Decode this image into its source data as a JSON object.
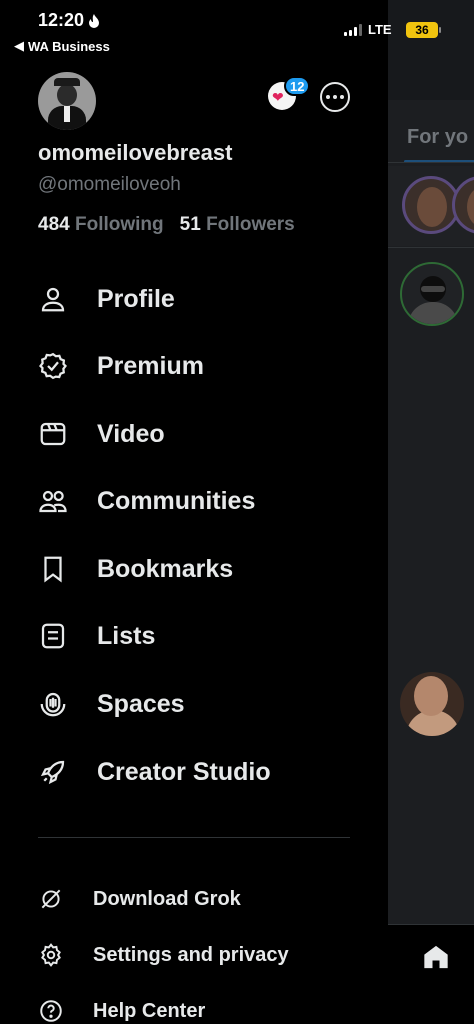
{
  "status_bar": {
    "time": "12:20",
    "back_app": "WA Business",
    "network": "LTE",
    "battery": "36"
  },
  "profile": {
    "display_name": "omomeilovebreast",
    "handle": "@omomeiloveoh",
    "following_count": "484",
    "following_label": "Following",
    "followers_count": "51",
    "followers_label": "Followers",
    "notification_badge": "12"
  },
  "menu": {
    "items": [
      {
        "label": "Profile",
        "icon": "person-icon"
      },
      {
        "label": "Premium",
        "icon": "verified-badge-icon"
      },
      {
        "label": "Video",
        "icon": "video-icon"
      },
      {
        "label": "Communities",
        "icon": "people-icon"
      },
      {
        "label": "Bookmarks",
        "icon": "bookmark-icon"
      },
      {
        "label": "Lists",
        "icon": "list-icon"
      },
      {
        "label": "Spaces",
        "icon": "spaces-icon"
      },
      {
        "label": "Creator Studio",
        "icon": "rocket-icon"
      }
    ]
  },
  "secondary_menu": {
    "items": [
      {
        "label": "Download Grok",
        "icon": "grok-icon"
      },
      {
        "label": "Settings and privacy",
        "icon": "gear-icon"
      },
      {
        "label": "Help Center",
        "icon": "help-icon"
      }
    ]
  },
  "background": {
    "tab_label": "For yo"
  },
  "colors": {
    "background": "#000000",
    "text_primary": "#e7e9ea",
    "text_secondary": "#71767b",
    "accent": "#1d9bf0",
    "battery": "#f1c40f"
  }
}
